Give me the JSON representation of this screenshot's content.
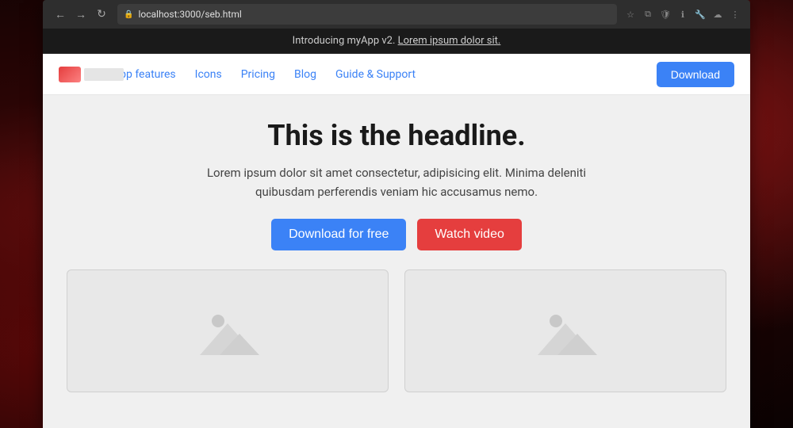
{
  "browser": {
    "url": "localhost:3000/seb.html",
    "back_icon": "←",
    "forward_icon": "→",
    "reload_icon": "↻"
  },
  "announcement": {
    "text": "Introducing myApp v2.",
    "link_text": "Lorem ipsum dolor sit."
  },
  "navbar": {
    "logo_alt": "myApp logo",
    "links": [
      {
        "label": "App features",
        "id": "app-features"
      },
      {
        "label": "Icons",
        "id": "icons"
      },
      {
        "label": "Pricing",
        "id": "pricing"
      },
      {
        "label": "Blog",
        "id": "blog"
      },
      {
        "label": "Guide & Support",
        "id": "guide-support"
      }
    ],
    "cta_label": "Download"
  },
  "hero": {
    "headline": "This is the headline.",
    "subtext": "Lorem ipsum dolor sit amet consectetur, adipisicing elit. Minima deleniti quibusdam perferendis veniam hic accusamus nemo.",
    "btn_primary": "Download for free",
    "btn_secondary": "Watch video"
  },
  "images": [
    {
      "alt": "placeholder image 1"
    },
    {
      "alt": "placeholder image 2"
    }
  ]
}
